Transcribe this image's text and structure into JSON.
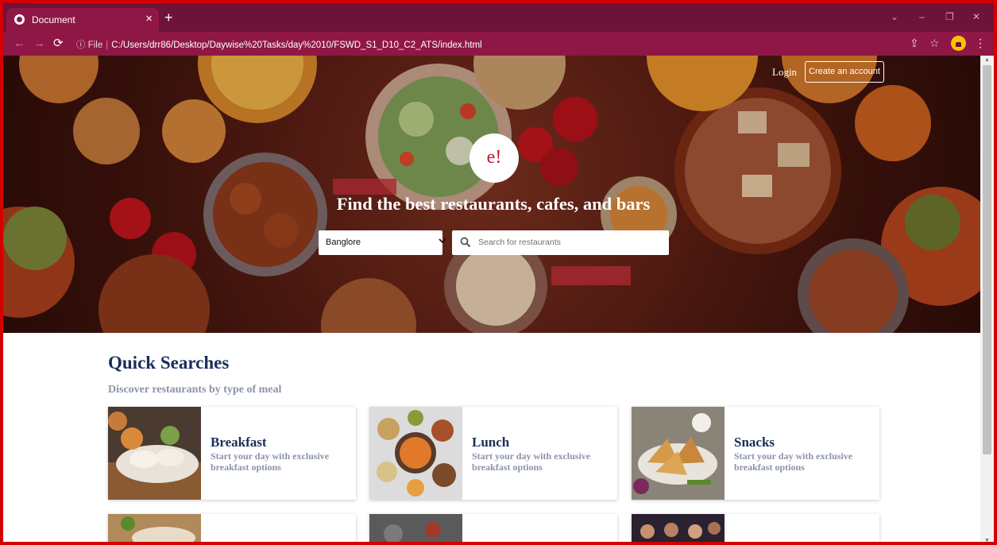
{
  "browser": {
    "tab_title": "Document",
    "tab_close": "×",
    "new_tab": "+",
    "url_scheme": "File",
    "url_path": "C:/Users/drr86/Desktop/Daywise%20Tasks/day%2010/FSWD_S1_D10_C2_ATS/index.html",
    "window_controls": [
      "⌄",
      "–",
      "❐",
      "✕"
    ]
  },
  "header": {
    "login": "Login",
    "create_account": "Create an account"
  },
  "hero": {
    "logo": "e!",
    "title": "Find the best restaurants, cafes, and bars",
    "location_value": "Banglore",
    "search_placeholder": "Search for restaurants"
  },
  "quick_searches": {
    "title": "Quick Searches",
    "subtitle": "Discover restaurants by type of meal",
    "cards": [
      {
        "title": "Breakfast",
        "description": "Start your day with exclusive breakfast options"
      },
      {
        "title": "Lunch",
        "description": "Start your day with exclusive breakfast options"
      },
      {
        "title": "Snacks",
        "description": "Start your day with exclusive breakfast options"
      }
    ]
  },
  "colors": {
    "tab_bar": "#6d1238",
    "toolbar": "#8f1746",
    "heading": "#192f59",
    "subtext": "#8a93a8",
    "logo_text": "#c5162a"
  },
  "icons": [
    "globe-icon",
    "close-icon",
    "plus-icon",
    "back-icon",
    "forward-icon",
    "reload-icon",
    "info-icon",
    "share-icon",
    "star-icon",
    "profile-icon",
    "menu-icon",
    "chevron-down-icon",
    "search-icon"
  ]
}
